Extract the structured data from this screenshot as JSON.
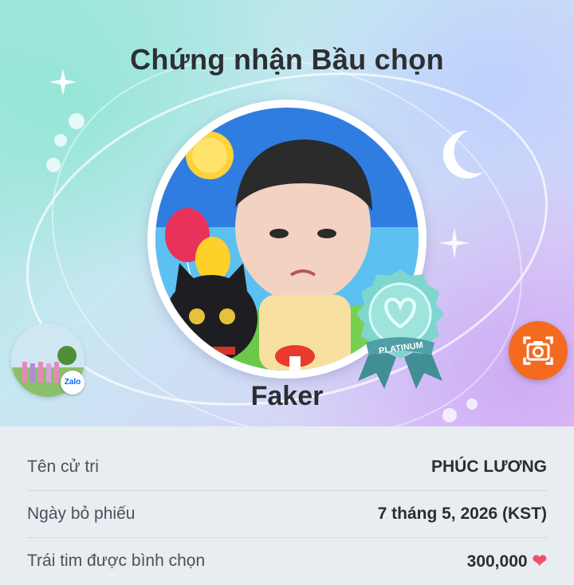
{
  "certificate": {
    "title": "Chứng nhận Bầu chọn",
    "candidate_name": "Faker",
    "badge_label": "PLATINUM"
  },
  "story": {
    "app_label": "Zalo"
  },
  "camera_button": {
    "icon": "camera-icon"
  },
  "details": [
    {
      "label": "Tên cử tri",
      "value": "PHÚC LƯƠNG"
    },
    {
      "label": "Ngày bỏ phiếu",
      "value": "7 tháng 5, 2026 (KST)"
    },
    {
      "label": "Trái tim được bình chọn",
      "value": "300,000",
      "icon": "heart-icon"
    }
  ],
  "colors": {
    "accent_orange": "#f46a1f",
    "heart": "#f0506a",
    "badge_teal": "#7fd6cf"
  }
}
